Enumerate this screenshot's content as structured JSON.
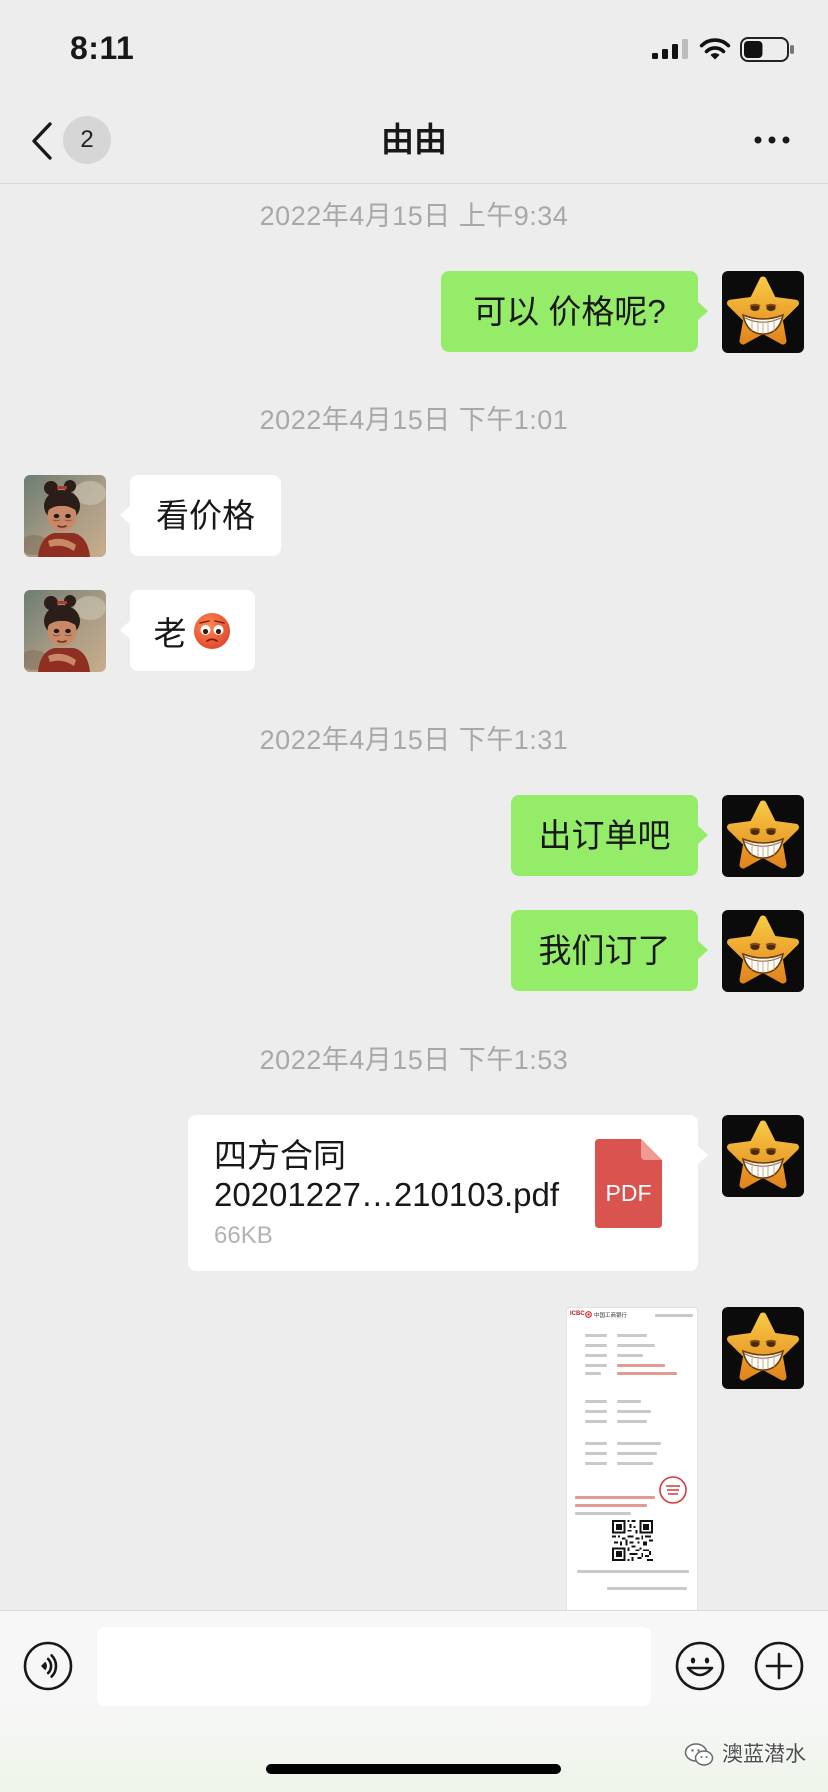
{
  "status_bar": {
    "time": "8:11",
    "signal_icon": "cellular-signal-icon",
    "wifi_icon": "wifi-icon",
    "battery_icon": "battery-icon",
    "battery_level": 0.45
  },
  "nav": {
    "back_icon": "chevron-left-icon",
    "unread_count": "2",
    "title": "由由",
    "more_icon": "more-dots-icon"
  },
  "chat": {
    "timestamps": [
      "2022年4月15日 上午9:34",
      "2022年4月15日 下午1:01",
      "2022年4月15日 下午1:31",
      "2022年4月15日 下午1:53"
    ],
    "messages": [
      {
        "outgoing": true,
        "avatar_icon": "star-avatar-icon",
        "text": "可以 价格呢?"
      },
      {
        "outgoing": false,
        "avatar_icon": "girl-avatar-icon",
        "text": "看价格"
      },
      {
        "outgoing": false,
        "avatar_icon": "girl-avatar-icon",
        "text": "老",
        "emoji_icon": "worried-face-icon"
      },
      {
        "outgoing": true,
        "avatar_icon": "star-avatar-icon",
        "text": "出订单吧"
      },
      {
        "outgoing": true,
        "avatar_icon": "star-avatar-icon",
        "text": "我们订了"
      },
      {
        "outgoing": true,
        "avatar_icon": "star-avatar-icon",
        "file": {
          "name_line1": "四方合同",
          "name_line2": "20201227…210103.pdf",
          "size": "66KB",
          "type_label": "PDF",
          "type_icon": "pdf-file-icon"
        }
      },
      {
        "outgoing": true,
        "avatar_icon": "star-avatar-icon",
        "image": {
          "icon": "bank-receipt-thumbnail-icon",
          "bank_logo": "ICBC",
          "bank_name": "中国工商银行"
        }
      }
    ]
  },
  "input_bar": {
    "voice_icon": "voice-mode-icon",
    "text_value": "",
    "emoji_icon": "emoji-icon",
    "plus_icon": "plus-circle-icon"
  },
  "watermark": {
    "icon": "wechat-logo-icon",
    "text": "澳蓝潜水"
  },
  "colors": {
    "background": "#ededed",
    "bubble_outgoing": "#95ec69",
    "bubble_incoming": "#ffffff",
    "timestamp": "#a8a8a8",
    "badge": "#d6d6d6",
    "pdf_icon": "#d9534f"
  }
}
